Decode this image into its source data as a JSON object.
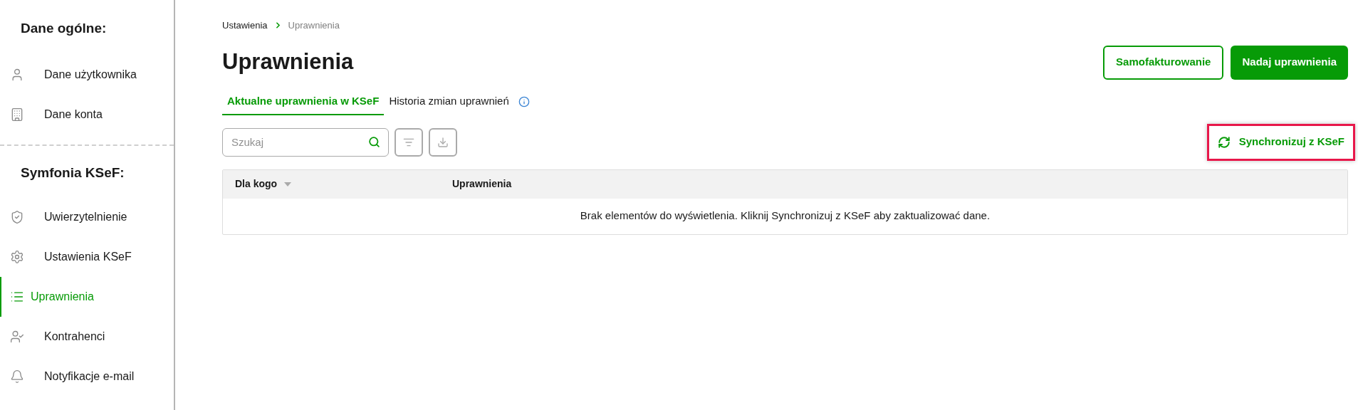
{
  "sidebar": {
    "sections": [
      {
        "heading": "Dane ogólne:",
        "items": [
          {
            "label": "Dane użytkownika",
            "selected": false
          },
          {
            "label": "Dane konta",
            "selected": false
          }
        ]
      },
      {
        "heading": "Symfonia KSeF:",
        "items": [
          {
            "label": "Uwierzytelnienie",
            "selected": false
          },
          {
            "label": "Ustawienia KSeF",
            "selected": false
          },
          {
            "label": "Uprawnienia",
            "selected": true
          },
          {
            "label": "Kontrahenci",
            "selected": false
          },
          {
            "label": "Notyfikacje e-mail",
            "selected": false
          }
        ]
      }
    ]
  },
  "breadcrumb": [
    "Ustawienia",
    "Uprawnienia"
  ],
  "title": "Uprawnienia",
  "header_buttons": [
    {
      "label": "Samofakturowanie",
      "kind": "outline"
    },
    {
      "label": "Nadaj uprawnienia",
      "kind": "filled"
    }
  ],
  "tabs": [
    {
      "label": "Aktualne uprawnienia w KSeF",
      "selected": true,
      "info": false
    },
    {
      "label": "Historia zmian uprawnień",
      "selected": false,
      "info": true
    }
  ],
  "search": {
    "placeholder": "Szukaj"
  },
  "sync_button": {
    "label": "Synchronizuj z KSeF",
    "highlighted": true
  },
  "table": {
    "columns": [
      {
        "label": "Dla kogo",
        "sortable": true
      },
      {
        "label": "Uprawnienia",
        "sortable": false
      }
    ],
    "empty_message": "Brak elementów do wyświetlenia. Kliknij Synchronizuj z KSeF aby zaktualizować dane."
  }
}
